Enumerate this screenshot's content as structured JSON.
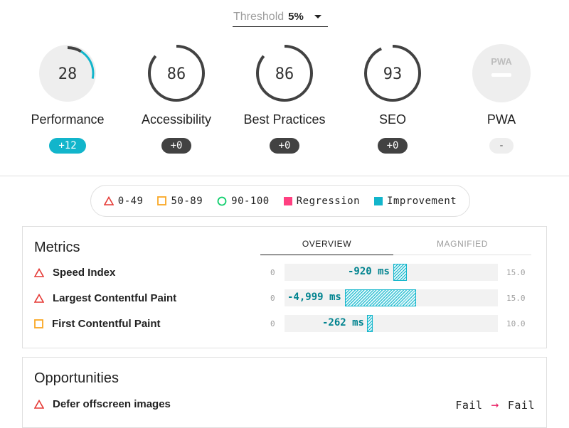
{
  "threshold": {
    "label": "Threshold",
    "value": "5%"
  },
  "gauges": [
    {
      "score": "28",
      "name": "Performance",
      "delta": "+12"
    },
    {
      "score": "86",
      "name": "Accessibility",
      "delta": "+0"
    },
    {
      "score": "86",
      "name": "Best Practices",
      "delta": "+0"
    },
    {
      "score": "93",
      "name": "SEO",
      "delta": "+0"
    },
    {
      "score": "PWA",
      "name": "PWA",
      "delta": "-"
    }
  ],
  "legend": {
    "fail": "0-49",
    "average": "50-89",
    "pass": "90-100",
    "regression": "Regression",
    "improvement": "Improvement"
  },
  "colors": {
    "fail": "#e53935",
    "average": "#f9a825",
    "pass": "#0cce6b",
    "regression": "#ff4081",
    "improvement": "#12b5cb",
    "gauge_ring": "#424242"
  },
  "metrics": {
    "title": "Metrics",
    "tabs": [
      "OVERVIEW",
      "MAGNIFIED"
    ],
    "rows": [
      {
        "icon": "triangle-warning-icon",
        "label": "Speed Index",
        "delta": "-920 ms",
        "min": "0",
        "max": "15.0"
      },
      {
        "icon": "triangle-warning-icon",
        "label": "Largest Contentful Paint",
        "delta": "-4,999 ms",
        "min": "0",
        "max": "15.0"
      },
      {
        "icon": "square-average-icon",
        "label": "First Contentful Paint",
        "delta": "-262 ms",
        "min": "0",
        "max": "10.0"
      }
    ]
  },
  "opportunities": {
    "title": "Opportunities",
    "rows": [
      {
        "icon": "triangle-warning-icon",
        "label": "Defer offscreen images",
        "from": "Fail",
        "to": "Fail"
      }
    ]
  }
}
